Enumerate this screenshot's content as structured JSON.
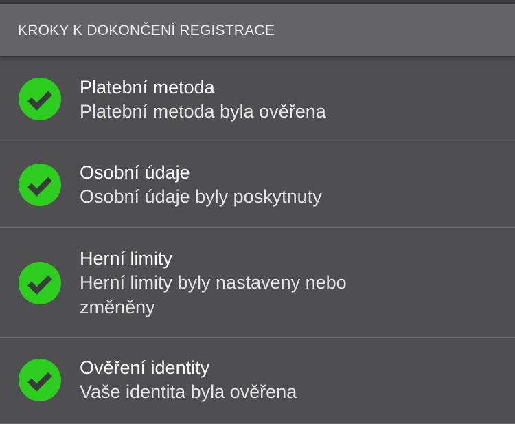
{
  "header": {
    "title": "KROKY K DOKONČENÍ REGISTRACE"
  },
  "colors": {
    "check_green": "#2ccd1e",
    "background": "#4f4f51",
    "header_background": "#656567"
  },
  "steps": [
    {
      "icon": "check-circle-icon",
      "title": "Platební metoda",
      "description": "Platební metoda byla ověřena"
    },
    {
      "icon": "check-circle-icon",
      "title": "Osobní údaje",
      "description": "Osobní údaje byly poskytnuty"
    },
    {
      "icon": "check-circle-icon",
      "title": "Herní limity",
      "description": "Herní limity byly nastaveny nebo změněny"
    },
    {
      "icon": "check-circle-icon",
      "title": "Ověření identity",
      "description": "Vaše identita byla ověřena"
    }
  ]
}
